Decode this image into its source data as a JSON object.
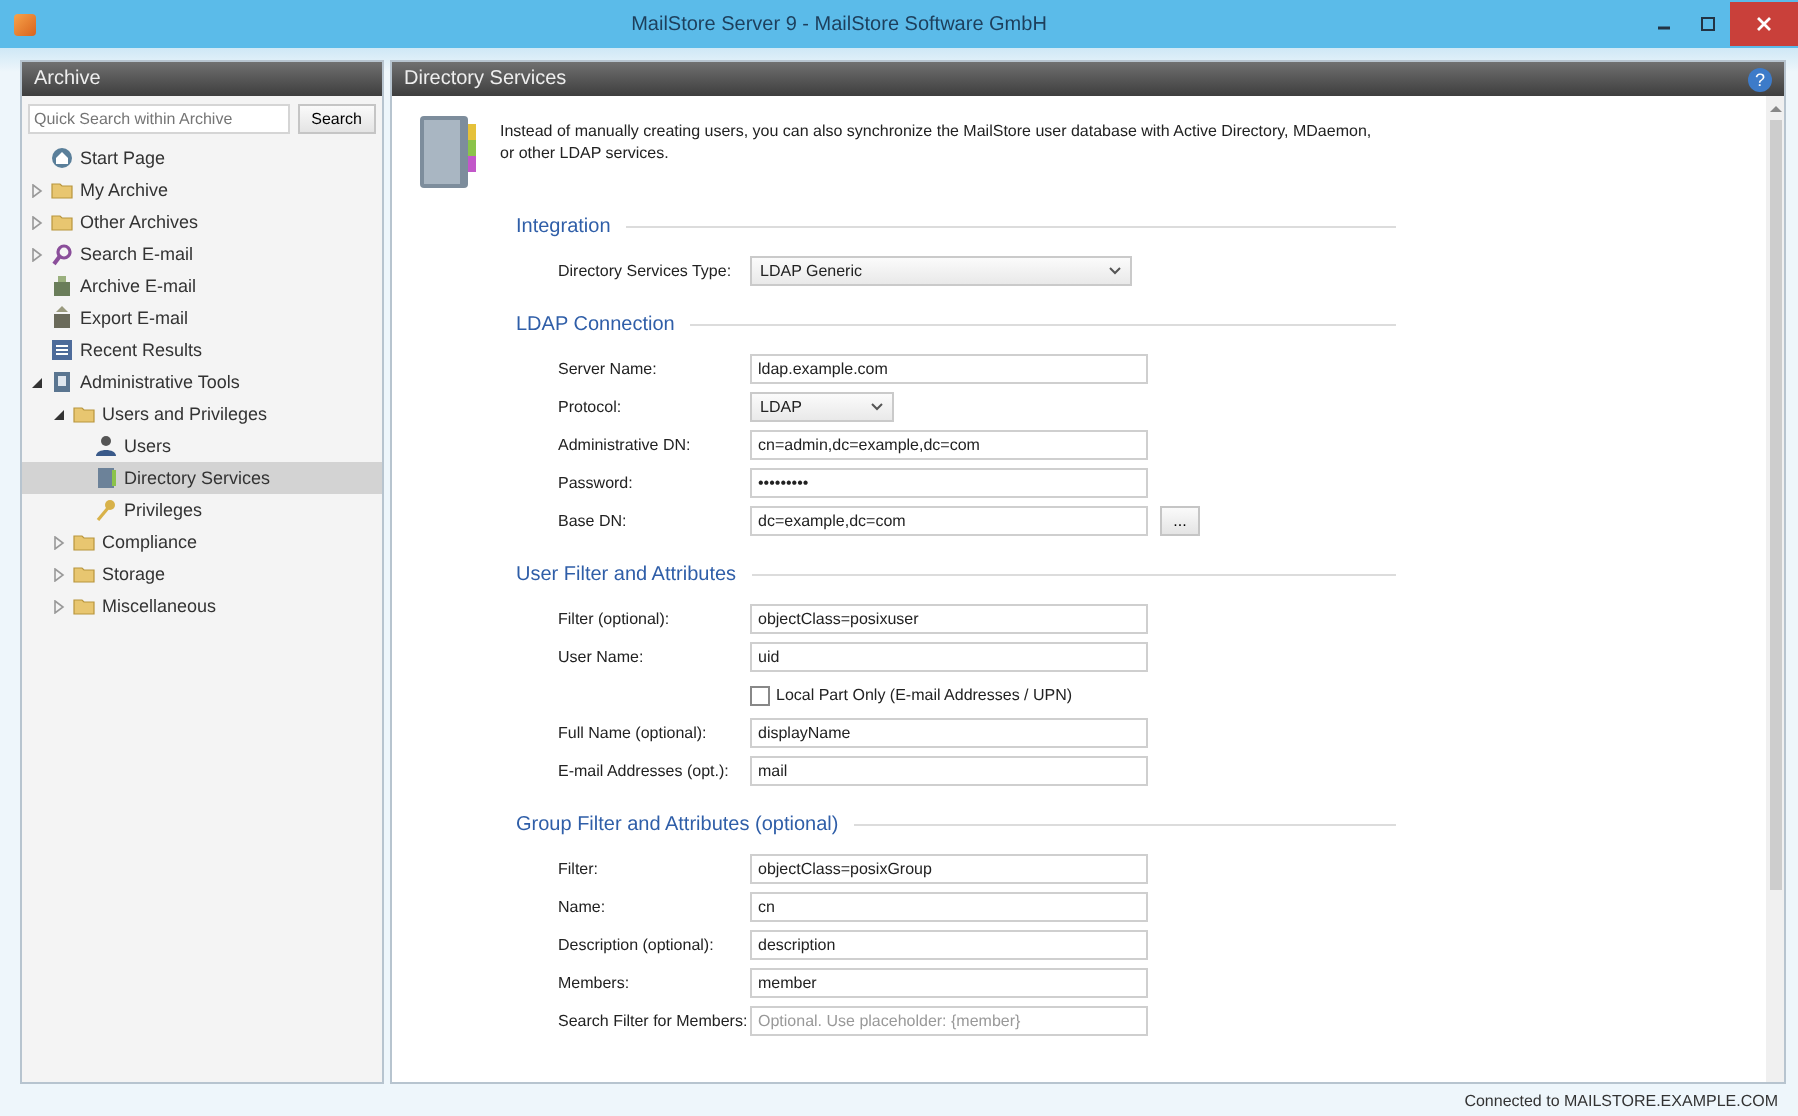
{
  "window": {
    "title": "MailStore Server 9 - MailStore Software GmbH"
  },
  "sidebar": {
    "title": "Archive",
    "search": {
      "placeholder": "Quick Search within Archive",
      "button": "Search"
    },
    "tree": [
      {
        "label": "Start Page",
        "kind": "home",
        "selected": false
      },
      {
        "label": "My Archive",
        "kind": "folder",
        "expanded": false,
        "selected": false
      },
      {
        "label": "Other Archives",
        "kind": "folder",
        "expanded": false,
        "selected": false
      },
      {
        "label": "Search E-mail",
        "kind": "search",
        "expanded": false,
        "selected": false
      },
      {
        "label": "Archive E-mail",
        "kind": "archive",
        "selected": false
      },
      {
        "label": "Export E-mail",
        "kind": "export",
        "selected": false
      },
      {
        "label": "Recent Results",
        "kind": "results",
        "selected": false
      },
      {
        "label": "Administrative Tools",
        "kind": "tools",
        "expanded": true,
        "selected": false,
        "children": [
          {
            "label": "Users and Privileges",
            "kind": "folder",
            "expanded": true,
            "selected": false,
            "children": [
              {
                "label": "Users",
                "kind": "user",
                "selected": false
              },
              {
                "label": "Directory Services",
                "kind": "directory",
                "selected": true
              },
              {
                "label": "Privileges",
                "kind": "key",
                "selected": false
              }
            ]
          },
          {
            "label": "Compliance",
            "kind": "folder",
            "expanded": false,
            "selected": false
          },
          {
            "label": "Storage",
            "kind": "folder",
            "expanded": false,
            "selected": false
          },
          {
            "label": "Miscellaneous",
            "kind": "folder",
            "expanded": false,
            "selected": false
          }
        ]
      }
    ]
  },
  "content": {
    "title": "Directory Services",
    "help": "?",
    "intro": "Instead of manually creating users, you can also synchronize the MailStore user database with Active Directory, MDaemon, or other LDAP services.",
    "sections": [
      {
        "title": "Integration",
        "fields": [
          {
            "kind": "select",
            "label": "Directory Services Type:",
            "value": "LDAP Generic"
          }
        ]
      },
      {
        "title": "LDAP Connection",
        "fields": [
          {
            "kind": "text",
            "label": "Server Name:",
            "value": "ldap.example.com"
          },
          {
            "kind": "short-select",
            "label": "Protocol:",
            "value": "LDAP"
          },
          {
            "kind": "text",
            "label": "Administrative DN:",
            "value": "cn=admin,dc=example,dc=com"
          },
          {
            "kind": "text",
            "label": "Password:",
            "value": "•••••••••"
          },
          {
            "kind": "browse",
            "label": "Base DN:",
            "value": "dc=example,dc=com",
            "button": "..."
          }
        ]
      },
      {
        "title": "User Filter and Attributes",
        "fields": [
          {
            "kind": "text",
            "label": "Filter (optional):",
            "value": "objectClass=posixuser"
          },
          {
            "kind": "text",
            "label": "User Name:",
            "value": "uid"
          },
          {
            "kind": "checkbox",
            "label": "Local Part Only (E-mail Addresses / UPN)",
            "checked": false
          },
          {
            "kind": "text",
            "label": "Full Name (optional):",
            "value": "displayName"
          },
          {
            "kind": "text",
            "label": "E-mail Addresses (opt.):",
            "value": "mail"
          }
        ]
      },
      {
        "title": "Group Filter and Attributes (optional)",
        "fields": [
          {
            "kind": "text",
            "label": "Filter:",
            "value": "objectClass=posixGroup"
          },
          {
            "kind": "text",
            "label": "Name:",
            "value": "cn"
          },
          {
            "kind": "text",
            "label": "Description (optional):",
            "value": "description"
          },
          {
            "kind": "text",
            "label": "Members:",
            "value": "member"
          },
          {
            "kind": "text",
            "label": "Search Filter for Members:",
            "placeholder": "Optional. Use placeholder: {member}"
          }
        ]
      }
    ]
  },
  "status_bar": {
    "text": "Connected to MAILSTORE.EXAMPLE.COM"
  }
}
